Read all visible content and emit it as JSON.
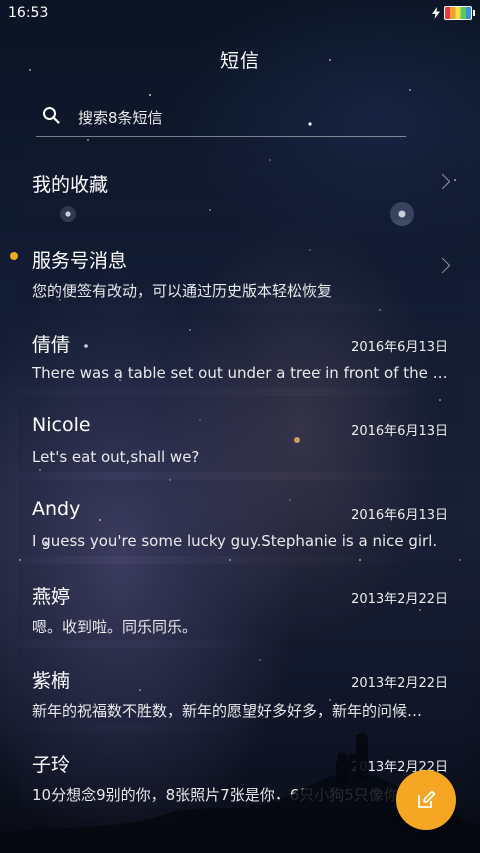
{
  "status_bar": {
    "time": "16:53"
  },
  "header": {
    "title": "短信"
  },
  "search": {
    "placeholder": "搜索8条短信"
  },
  "conversations": [
    {
      "title": "我的收藏",
      "date": "",
      "preview": ""
    },
    {
      "title": "服务号消息",
      "date": "",
      "preview": "您的便签有改动，可以通过历史版本轻松恢复",
      "unread": true
    },
    {
      "title": "倩倩",
      "date": "2016年6月13日",
      "preview": "There was a table set out under a tree in front of the ho…"
    },
    {
      "title": "Nicole",
      "date": "2016年6月13日",
      "preview": "Let's eat out,shall we?"
    },
    {
      "title": "Andy",
      "date": "2016年6月13日",
      "preview": "I guess you're some lucky guy.Stephanie is a nice girl."
    },
    {
      "title": "燕婷",
      "date": "2013年2月22日",
      "preview": "嗯。收到啦。同乐同乐。"
    },
    {
      "title": "紫楠",
      "date": "2013年2月22日",
      "preview": "新年的祝福数不胜数，新年的愿望好多好多，新年的问候…"
    },
    {
      "title": "子玲",
      "date": "2013年2月22日",
      "preview": "10分想念9别的你，8张照片7张是你，6只小狗5只像你"
    }
  ],
  "colors": {
    "accent": "#f5a623"
  },
  "icons": {
    "search": "search-icon",
    "compose": "compose-icon",
    "battery": "battery-icon",
    "charging": "charging-icon"
  }
}
